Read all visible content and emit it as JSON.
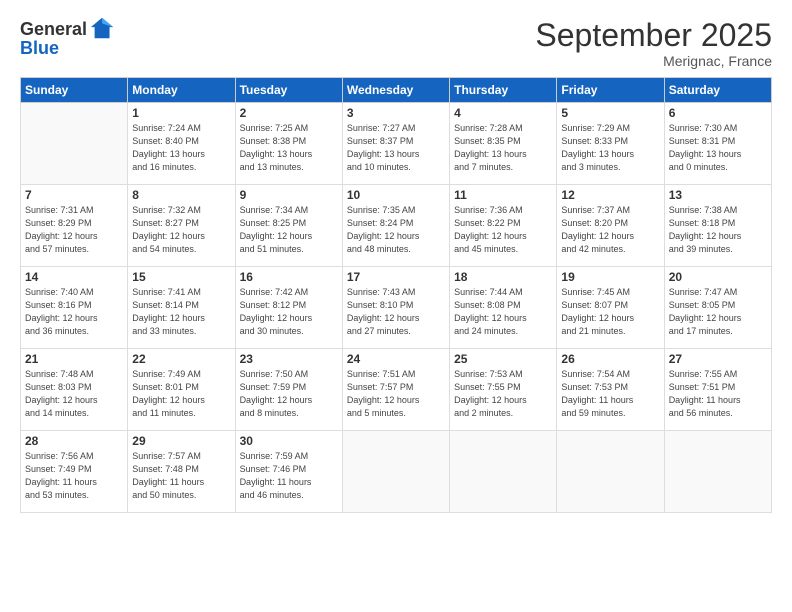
{
  "header": {
    "logo_line1": "General",
    "logo_line2": "Blue",
    "month_title": "September 2025",
    "subtitle": "Merignac, France"
  },
  "days_of_week": [
    "Sunday",
    "Monday",
    "Tuesday",
    "Wednesday",
    "Thursday",
    "Friday",
    "Saturday"
  ],
  "weeks": [
    [
      {
        "day": "",
        "info": ""
      },
      {
        "day": "1",
        "info": "Sunrise: 7:24 AM\nSunset: 8:40 PM\nDaylight: 13 hours\nand 16 minutes."
      },
      {
        "day": "2",
        "info": "Sunrise: 7:25 AM\nSunset: 8:38 PM\nDaylight: 13 hours\nand 13 minutes."
      },
      {
        "day": "3",
        "info": "Sunrise: 7:27 AM\nSunset: 8:37 PM\nDaylight: 13 hours\nand 10 minutes."
      },
      {
        "day": "4",
        "info": "Sunrise: 7:28 AM\nSunset: 8:35 PM\nDaylight: 13 hours\nand 7 minutes."
      },
      {
        "day": "5",
        "info": "Sunrise: 7:29 AM\nSunset: 8:33 PM\nDaylight: 13 hours\nand 3 minutes."
      },
      {
        "day": "6",
        "info": "Sunrise: 7:30 AM\nSunset: 8:31 PM\nDaylight: 13 hours\nand 0 minutes."
      }
    ],
    [
      {
        "day": "7",
        "info": "Sunrise: 7:31 AM\nSunset: 8:29 PM\nDaylight: 12 hours\nand 57 minutes."
      },
      {
        "day": "8",
        "info": "Sunrise: 7:32 AM\nSunset: 8:27 PM\nDaylight: 12 hours\nand 54 minutes."
      },
      {
        "day": "9",
        "info": "Sunrise: 7:34 AM\nSunset: 8:25 PM\nDaylight: 12 hours\nand 51 minutes."
      },
      {
        "day": "10",
        "info": "Sunrise: 7:35 AM\nSunset: 8:24 PM\nDaylight: 12 hours\nand 48 minutes."
      },
      {
        "day": "11",
        "info": "Sunrise: 7:36 AM\nSunset: 8:22 PM\nDaylight: 12 hours\nand 45 minutes."
      },
      {
        "day": "12",
        "info": "Sunrise: 7:37 AM\nSunset: 8:20 PM\nDaylight: 12 hours\nand 42 minutes."
      },
      {
        "day": "13",
        "info": "Sunrise: 7:38 AM\nSunset: 8:18 PM\nDaylight: 12 hours\nand 39 minutes."
      }
    ],
    [
      {
        "day": "14",
        "info": "Sunrise: 7:40 AM\nSunset: 8:16 PM\nDaylight: 12 hours\nand 36 minutes."
      },
      {
        "day": "15",
        "info": "Sunrise: 7:41 AM\nSunset: 8:14 PM\nDaylight: 12 hours\nand 33 minutes."
      },
      {
        "day": "16",
        "info": "Sunrise: 7:42 AM\nSunset: 8:12 PM\nDaylight: 12 hours\nand 30 minutes."
      },
      {
        "day": "17",
        "info": "Sunrise: 7:43 AM\nSunset: 8:10 PM\nDaylight: 12 hours\nand 27 minutes."
      },
      {
        "day": "18",
        "info": "Sunrise: 7:44 AM\nSunset: 8:08 PM\nDaylight: 12 hours\nand 24 minutes."
      },
      {
        "day": "19",
        "info": "Sunrise: 7:45 AM\nSunset: 8:07 PM\nDaylight: 12 hours\nand 21 minutes."
      },
      {
        "day": "20",
        "info": "Sunrise: 7:47 AM\nSunset: 8:05 PM\nDaylight: 12 hours\nand 17 minutes."
      }
    ],
    [
      {
        "day": "21",
        "info": "Sunrise: 7:48 AM\nSunset: 8:03 PM\nDaylight: 12 hours\nand 14 minutes."
      },
      {
        "day": "22",
        "info": "Sunrise: 7:49 AM\nSunset: 8:01 PM\nDaylight: 12 hours\nand 11 minutes."
      },
      {
        "day": "23",
        "info": "Sunrise: 7:50 AM\nSunset: 7:59 PM\nDaylight: 12 hours\nand 8 minutes."
      },
      {
        "day": "24",
        "info": "Sunrise: 7:51 AM\nSunset: 7:57 PM\nDaylight: 12 hours\nand 5 minutes."
      },
      {
        "day": "25",
        "info": "Sunrise: 7:53 AM\nSunset: 7:55 PM\nDaylight: 12 hours\nand 2 minutes."
      },
      {
        "day": "26",
        "info": "Sunrise: 7:54 AM\nSunset: 7:53 PM\nDaylight: 11 hours\nand 59 minutes."
      },
      {
        "day": "27",
        "info": "Sunrise: 7:55 AM\nSunset: 7:51 PM\nDaylight: 11 hours\nand 56 minutes."
      }
    ],
    [
      {
        "day": "28",
        "info": "Sunrise: 7:56 AM\nSunset: 7:49 PM\nDaylight: 11 hours\nand 53 minutes."
      },
      {
        "day": "29",
        "info": "Sunrise: 7:57 AM\nSunset: 7:48 PM\nDaylight: 11 hours\nand 50 minutes."
      },
      {
        "day": "30",
        "info": "Sunrise: 7:59 AM\nSunset: 7:46 PM\nDaylight: 11 hours\nand 46 minutes."
      },
      {
        "day": "",
        "info": ""
      },
      {
        "day": "",
        "info": ""
      },
      {
        "day": "",
        "info": ""
      },
      {
        "day": "",
        "info": ""
      }
    ]
  ]
}
